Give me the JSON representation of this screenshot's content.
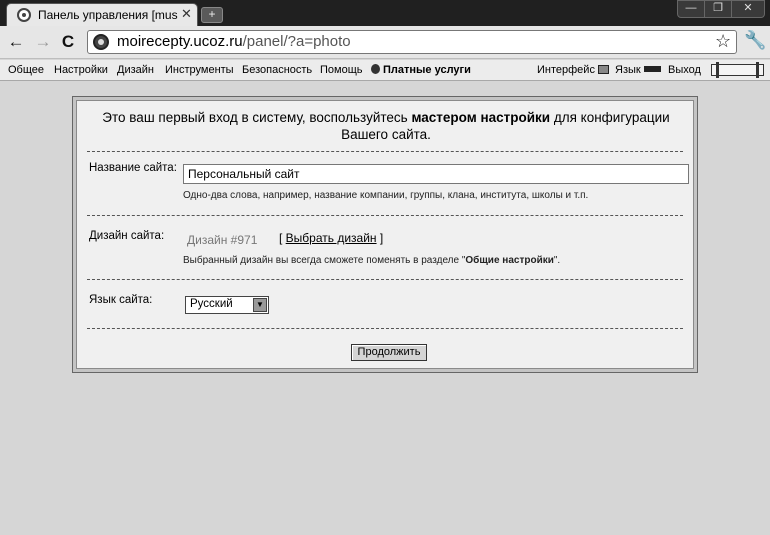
{
  "browser": {
    "tab_title": "Панель управления [musc",
    "tab_close": "✕",
    "new_tab": "+",
    "window_controls": {
      "minimize": "—",
      "maximize": "❐",
      "close": "✕"
    },
    "url_host": "moirecepty.ucoz.ru",
    "url_path": "/panel/?a=photo"
  },
  "menu": {
    "items": [
      "Общее",
      "Настройки",
      "Дизайн",
      "Инструменты",
      "Безопасность",
      "Помощь"
    ],
    "paid": "Платные услуги",
    "interface_label": "Интерфейс",
    "language_label": "Язык",
    "logout": "Выход"
  },
  "dialog": {
    "intro_before": "Это ваш первый вход в систему, воспользуйтесь ",
    "intro_bold": "мастером настройки",
    "intro_after": " для конфигурации",
    "intro_line2": "Вашего сайта.",
    "site_name_label": "Название сайта:",
    "site_name_value": "Персональный сайт",
    "site_name_hint": "Одно-два слова, например, название компании, группы, клана, института, школы и т.п.",
    "design_label": "Дизайн сайта:",
    "design_value": "Дизайн #971",
    "design_link_open": "[ ",
    "design_link": "Выбрать дизайн",
    "design_link_close": " ]",
    "design_hint_before": "Выбранный дизайн вы всегда сможете поменять в разделе \"",
    "design_hint_bold": "Общие настройки",
    "design_hint_after": "\".",
    "language_label": "Язык сайта:",
    "language_value": "Русский",
    "continue_button": "Продолжить"
  },
  "colors": {
    "page_bg": "#d6d6d6",
    "titlebar": "#202020",
    "dialog_bg": "#f0f0f0"
  }
}
